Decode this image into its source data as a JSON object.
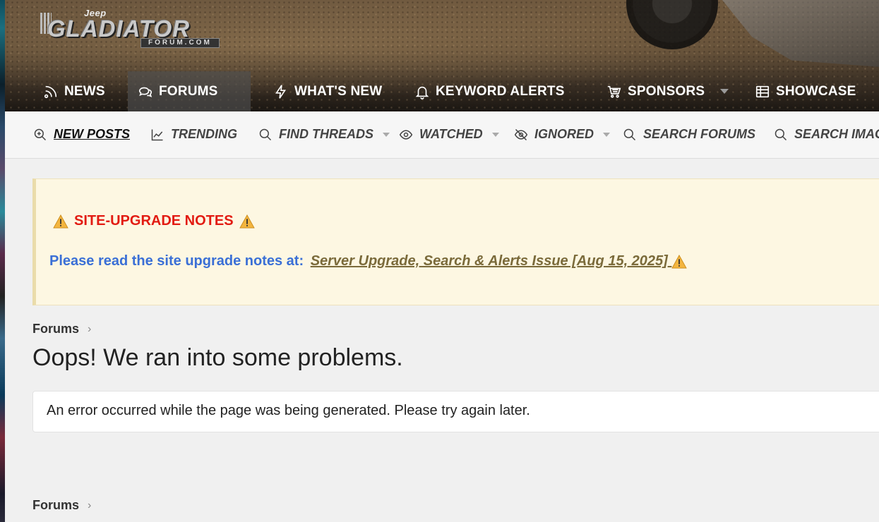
{
  "site": {
    "logo_top": "Jeep",
    "logo_main": "GLADIATOR",
    "logo_sub": "FORUM.COM"
  },
  "main_nav": [
    {
      "label": "NEWS",
      "icon": "news-icon"
    },
    {
      "label": "FORUMS",
      "icon": "forums-chat-icon",
      "active": true
    },
    {
      "label": "WHAT'S NEW",
      "icon": "bolt-icon"
    },
    {
      "label": "KEYWORD ALERTS",
      "icon": "bell-icon"
    },
    {
      "label": "SPONSORS",
      "icon": "cart-icon",
      "has_dropdown": true
    },
    {
      "label": "SHOWCASE",
      "icon": "table-icon"
    }
  ],
  "sub_nav": [
    {
      "label": "NEW POSTS",
      "icon": "zoom-plus-icon",
      "current": true
    },
    {
      "label": "TRENDING",
      "icon": "trending-chart-icon"
    },
    {
      "label": "FIND THREADS",
      "icon": "search-icon",
      "has_dropdown": true
    },
    {
      "label": "WATCHED",
      "icon": "eye-icon",
      "has_dropdown": true
    },
    {
      "label": "IGNORED",
      "icon": "eye-slash-icon",
      "has_dropdown": true
    },
    {
      "label": "SEARCH FORUMS",
      "icon": "search-icon"
    },
    {
      "label": "SEARCH IMAG",
      "icon": "search-icon"
    }
  ],
  "notice": {
    "title": "SITE-UPGRADE NOTES",
    "body_prefix": "Please read the site upgrade notes at:",
    "link_text": "Server Upgrade, Search & Alerts Issue [Aug 15, 2025]"
  },
  "breadcrumb_top": "Forums",
  "page_title": "Oops! We ran into some problems.",
  "error_message": "An error occurred while the page was being generated. Please try again later.",
  "breadcrumb_bottom": "Forums",
  "colors": {
    "notice_title": "#e21b12",
    "notice_body": "#3a6fd6",
    "notice_bg": "#fdf7e2"
  }
}
